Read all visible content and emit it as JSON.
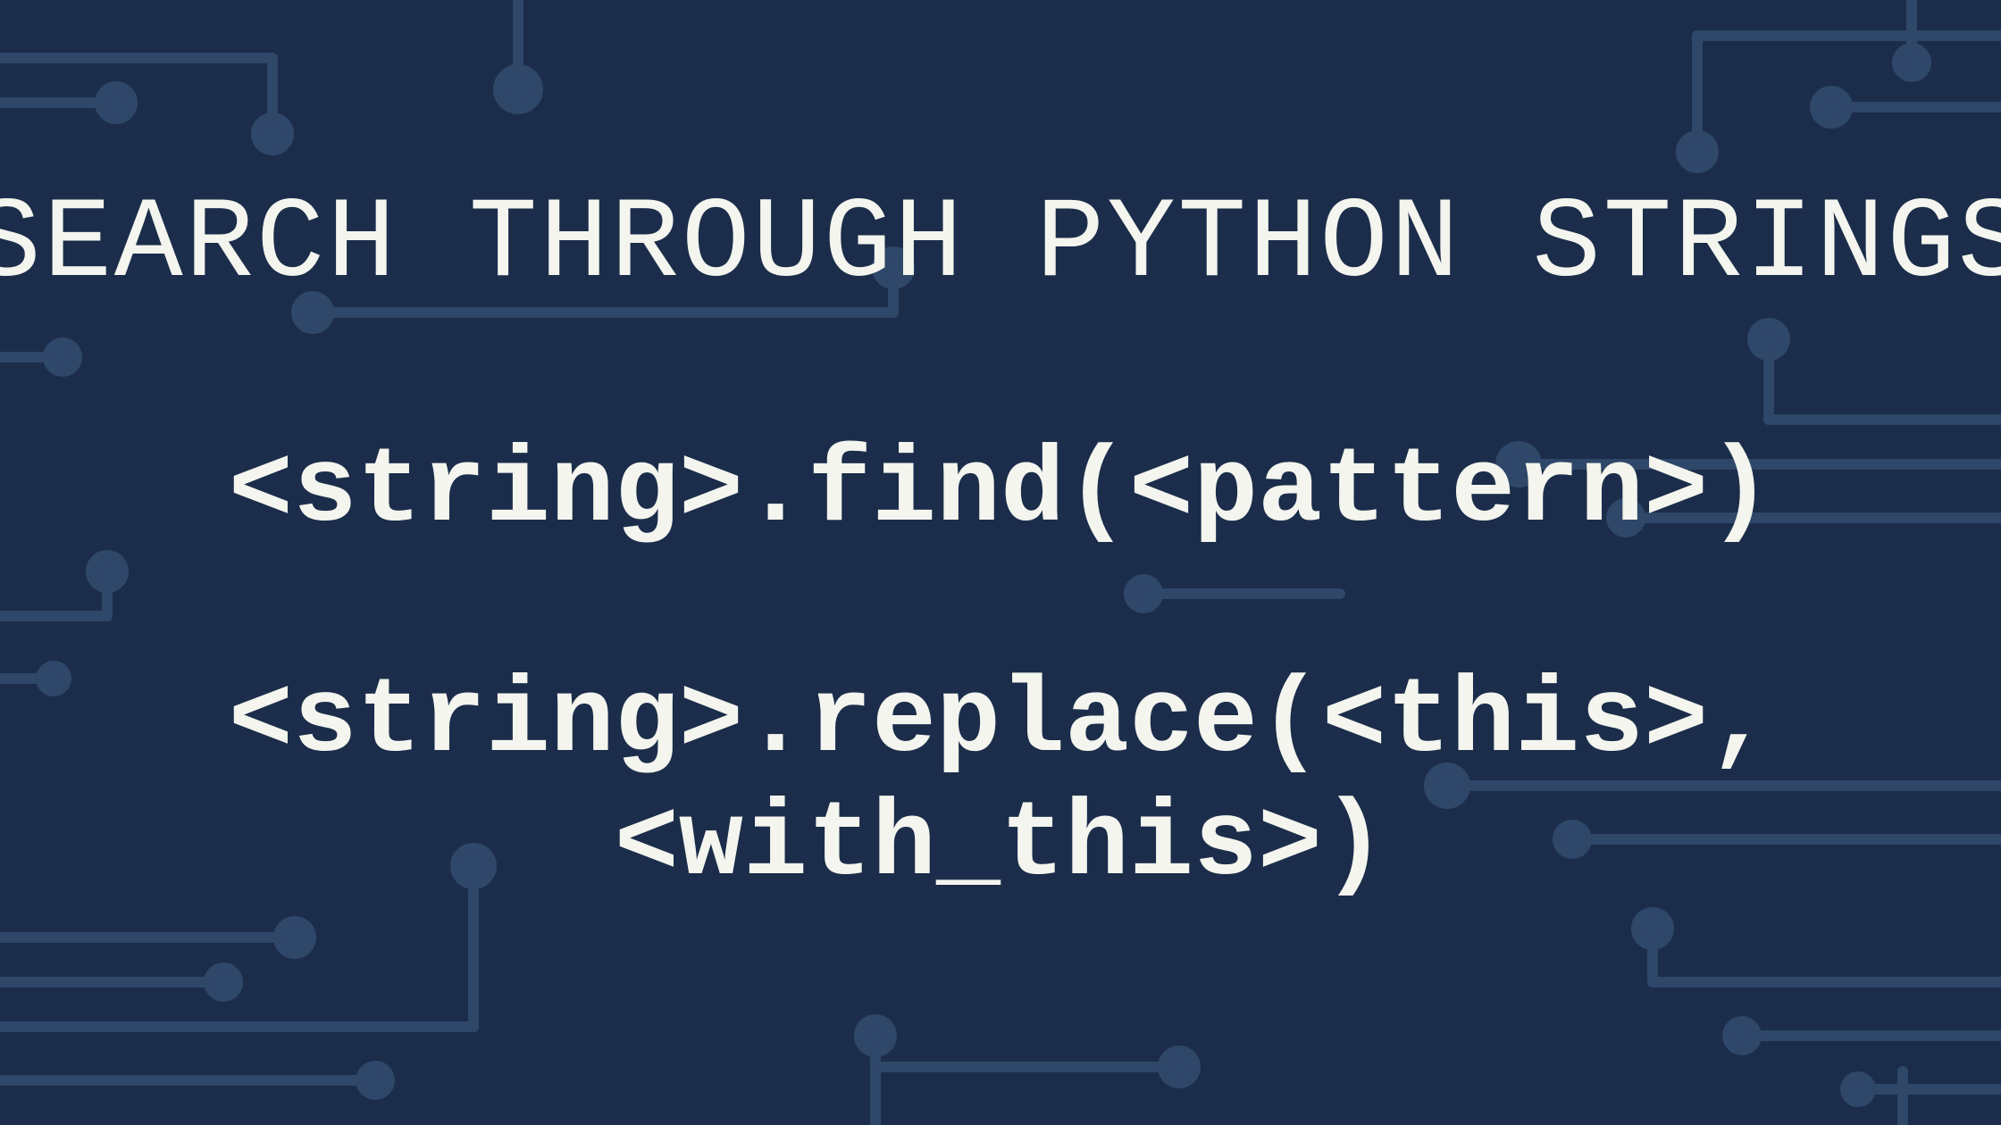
{
  "colors": {
    "background": "#1b2d4a",
    "circuit": "#2f4769",
    "text": "#f3f5ee"
  },
  "title": "SEARCH THROUGH PYTHON STRINGS",
  "code_lines": {
    "find": "<string>.find(<pattern>)",
    "replace_line1": "<string>.replace(<this>,",
    "replace_line2": "<with_this>)"
  }
}
